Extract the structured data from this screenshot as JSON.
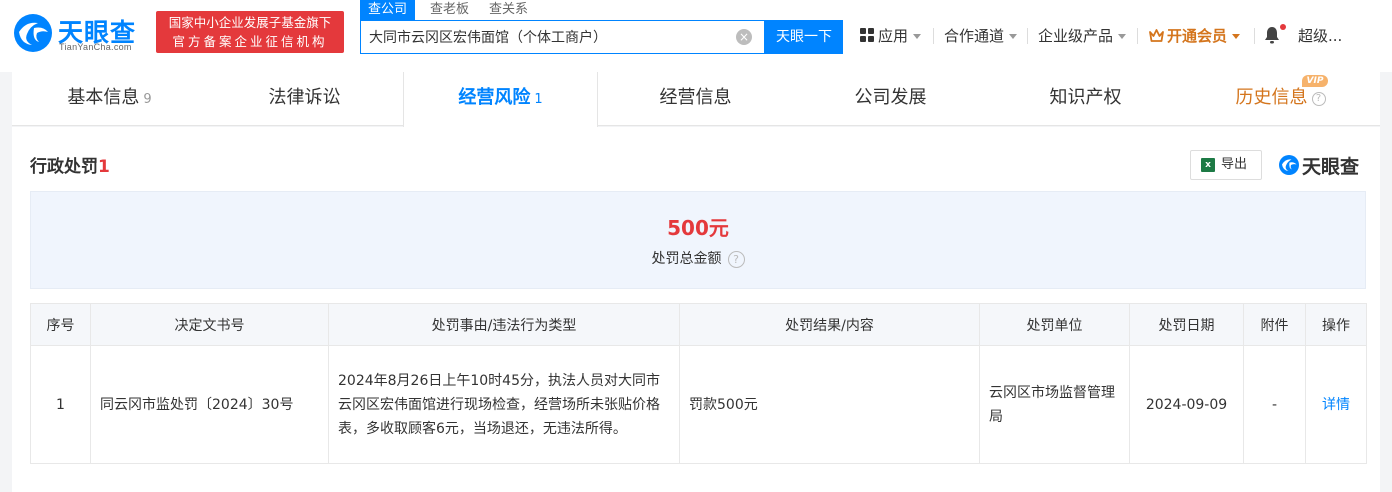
{
  "header": {
    "logo_text": "天眼查",
    "logo_sub": "TianYanCha.com",
    "slogan_line1": "国家中小企业发展子基金旗下",
    "slogan_line2": "官方备案企业征信机构",
    "search_tabs": [
      "查公司",
      "查老板",
      "查关系"
    ],
    "search_value": "大同市云冈区宏伟面馆（个体工商户）",
    "search_button": "天眼一下",
    "nav": {
      "app": "应用",
      "channel": "合作通道",
      "enterprise": "企业级产品",
      "vip": "开通会员",
      "user": "超级..."
    }
  },
  "tabs": [
    {
      "label": "基本信息",
      "count": "9"
    },
    {
      "label": "法律诉讼",
      "count": ""
    },
    {
      "label": "经营风险",
      "count": "1"
    },
    {
      "label": "经营信息",
      "count": ""
    },
    {
      "label": "公司发展",
      "count": ""
    },
    {
      "label": "知识产权",
      "count": ""
    },
    {
      "label": "历史信息",
      "count": ""
    }
  ],
  "vip_tag": "VIP",
  "section": {
    "title": "行政处罚",
    "count": "1",
    "export_label": "导出",
    "brand": "天眼查"
  },
  "summary": {
    "amount": "500元",
    "label": "处罚总金额"
  },
  "table": {
    "headers": [
      "序号",
      "决定文书号",
      "处罚事由/违法行为类型",
      "处罚结果/内容",
      "处罚单位",
      "处罚日期",
      "附件",
      "操作"
    ],
    "rows": [
      {
        "index": "1",
        "doc_no": "同云冈市监处罚〔2024〕30号",
        "reason": "2024年8月26日上午10时45分，执法人员对大同市云冈区宏伟面馆进行现场检查，经营场所未张贴价格表，多收取顾客6元，当场退还，无违法所得。",
        "result": "罚款500元",
        "unit": "云冈区市场监督管理局",
        "date": "2024-09-09",
        "attachment": "-",
        "action": "详情"
      }
    ]
  },
  "colors": {
    "brand_blue": "#0084ff",
    "accent_red": "#e4393c",
    "vip_orange": "#d4751d"
  }
}
